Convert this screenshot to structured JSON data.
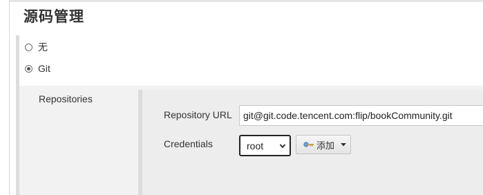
{
  "section": {
    "title": "源码管理"
  },
  "scm": {
    "options": [
      {
        "label": "无",
        "selected": false
      },
      {
        "label": "Git",
        "selected": true
      }
    ]
  },
  "git": {
    "repositories_label": "Repositories",
    "repository_url_label": "Repository URL",
    "repository_url_value": "git@git.code.tencent.com:flip/bookCommunity.git",
    "credentials_label": "Credentials",
    "credentials_value": "root",
    "add_button_label": "添加",
    "add_button_icon": "key-icon",
    "select_icon": "chevron-down-icon",
    "add_dropdown_icon": "caret-down-icon"
  }
}
